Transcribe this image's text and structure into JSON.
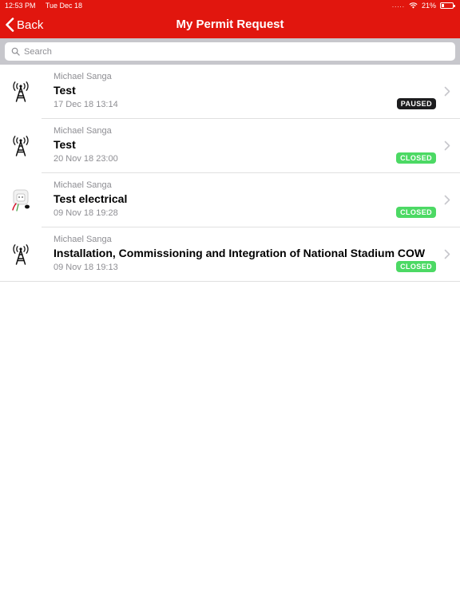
{
  "status_bar": {
    "time": "12:53 PM",
    "date": "Tue Dec 18",
    "signal": ".....",
    "wifi_icon": "wifi-icon",
    "battery_text": "21%",
    "battery_level": 0.21
  },
  "nav": {
    "back_label": "Back",
    "title": "My Permit Request",
    "accent_color": "#e1160e"
  },
  "search": {
    "placeholder": "Search",
    "value": ""
  },
  "permits": [
    {
      "author": "Michael Sanga",
      "title": "Test",
      "date": "17 Dec 18 13:14",
      "status": "PAUSED",
      "status_color": "#1c1c1e",
      "icon": "antenna-tower-icon"
    },
    {
      "author": "Michael Sanga",
      "title": "Test",
      "date": "20 Nov 18 23:00",
      "status": "CLOSED",
      "status_color": "#4cd964",
      "icon": "antenna-tower-icon"
    },
    {
      "author": "Michael Sanga",
      "title": "Test electrical",
      "date": "09 Nov 18 19:28",
      "status": "CLOSED",
      "status_color": "#4cd964",
      "icon": "electrical-plug-icon"
    },
    {
      "author": "Michael Sanga",
      "title": "Installation, Commissioning and Integration of National Stadium COW",
      "date": "09 Nov 18 19:13",
      "status": "CLOSED",
      "status_color": "#4cd964",
      "icon": "antenna-tower-icon"
    }
  ]
}
